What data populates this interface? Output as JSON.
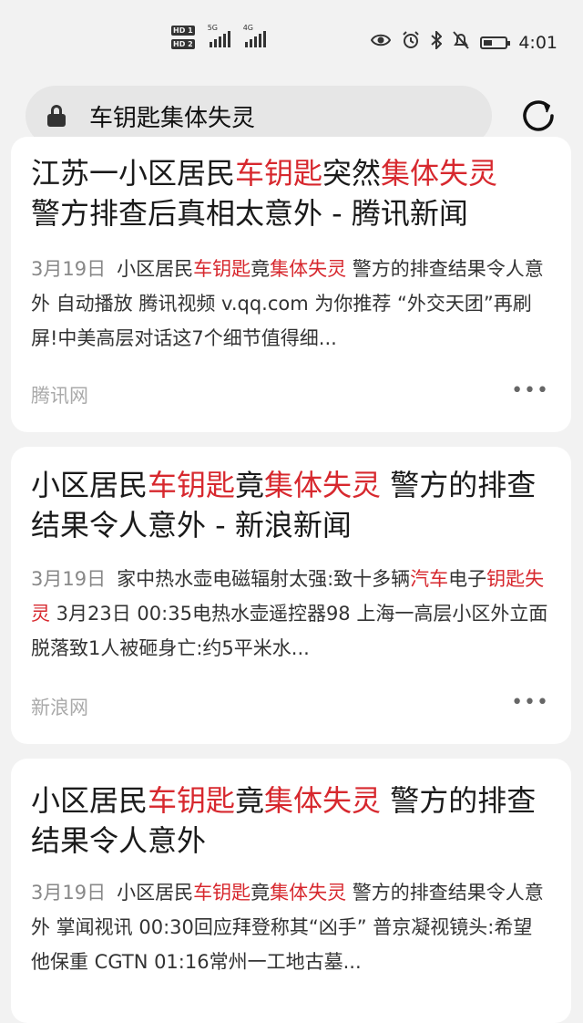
{
  "status_bar": {
    "hd1": "HD 1",
    "hd2": "HD 2",
    "sig1_label": "5G",
    "sig2_label": "4G",
    "time": "4:01",
    "battery_level": 0.4
  },
  "search": {
    "query": "车钥匙集体失灵"
  },
  "results": [
    {
      "title_prefix": "江苏一小区居民",
      "title_hl1": "车钥匙",
      "title_mid": "突然",
      "title_hl2": "集体失灵",
      "title_suffix": "警方排查后真相太意外 - 腾讯新闻",
      "date": "3月19日",
      "snip_a": "小区居民",
      "snip_hl1": "车钥匙",
      "snip_b": "竟",
      "snip_hl2": "集体失灵",
      "snip_c": " 警方的排查结果令人意外 自动播放 腾讯视频 v.qq.com 为你推荐 “外交天团”再刷屏!中美高层对话这7个细节值得细...",
      "source": "腾讯网"
    },
    {
      "title_prefix": "小区居民",
      "title_hl1": "车钥匙",
      "title_mid": "竟",
      "title_hl2": "集体失灵",
      "title_suffix": " 警方的排查结果令人意外 - 新浪新闻",
      "date": "3月19日",
      "snip_a": "家中热水壶电磁辐射太强:致十多辆",
      "snip_hl1": "汽车",
      "snip_b": "电子",
      "snip_hl2": "钥匙失灵",
      "snip_c": " 3月23日 00:35电热水壶遥控器98 上海一高层小区外立面脱落致1人被砸身亡:约5平米水...",
      "source": "新浪网"
    },
    {
      "title_prefix": "小区居民",
      "title_hl1": "车钥匙",
      "title_mid": "竟",
      "title_hl2": "集体失灵",
      "title_suffix": " 警方的排查结果令人意外",
      "date": "3月19日",
      "snip_a": "小区居民",
      "snip_hl1": "车钥匙",
      "snip_b": "竟",
      "snip_hl2": "集体失灵",
      "snip_c": " 警方的排查结果令人意外 掌闻视讯 00:30回应拜登称其“凶手” 普京凝视镜头:希望他保重 CGTN 01:16常州一工地古墓..."
    }
  ],
  "more_glyph": "•••"
}
